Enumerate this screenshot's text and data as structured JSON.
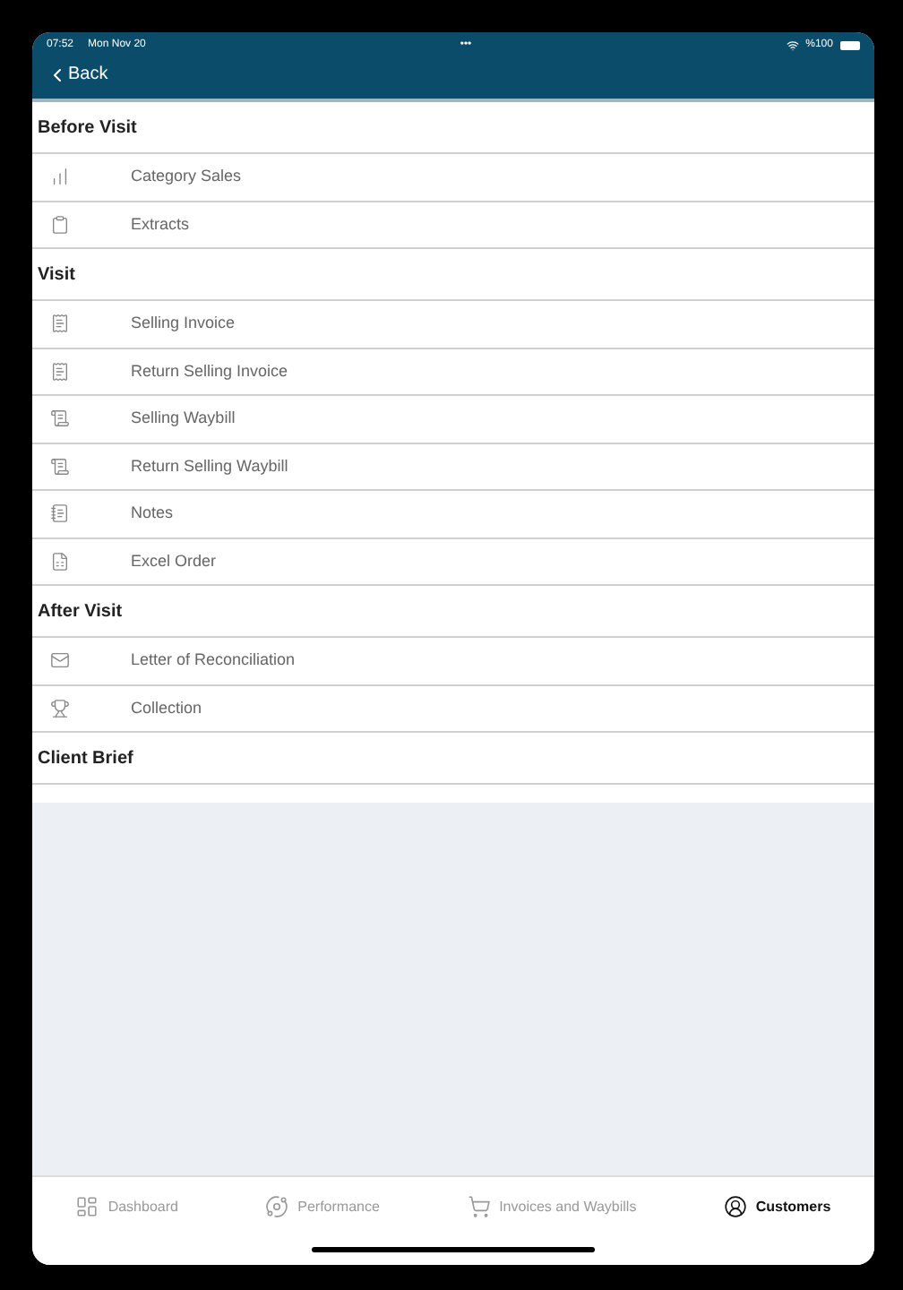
{
  "status_bar": {
    "time": "07:52",
    "date": "Mon Nov 20",
    "dots": "•••",
    "battery": "%100"
  },
  "nav": {
    "back": "Back"
  },
  "sections": [
    {
      "title": "Before Visit",
      "items": [
        "Category Sales",
        "Extracts"
      ]
    },
    {
      "title": "Visit",
      "items": [
        "Selling Invoice",
        "Return Selling Invoice",
        "Selling Waybill",
        "Return Selling Waybill",
        "Notes",
        "Excel Order"
      ]
    },
    {
      "title": "After Visit",
      "items": [
        "Letter of Reconciliation",
        "Collection"
      ]
    },
    {
      "title": "Client Brief"
    }
  ],
  "tabs": [
    {
      "label": "Dashboard",
      "selected": false
    },
    {
      "label": "Performance",
      "selected": false
    },
    {
      "label": "Invoices and Waybills",
      "selected": false
    },
    {
      "label": "Customers",
      "selected": true
    }
  ]
}
